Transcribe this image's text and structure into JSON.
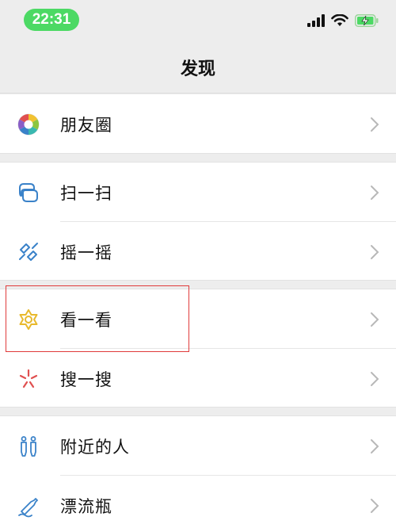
{
  "status_bar": {
    "time": "22:31",
    "icons": [
      "signal-icon",
      "wifi-icon",
      "battery-charging-icon"
    ],
    "accent": "#4cd964"
  },
  "nav": {
    "title": "发现"
  },
  "groups": [
    {
      "items": [
        {
          "label": "朋友圈",
          "icon": "moments-icon"
        }
      ]
    },
    {
      "items": [
        {
          "label": "扫一扫",
          "icon": "scan-icon"
        },
        {
          "label": "摇一摇",
          "icon": "shake-icon"
        }
      ]
    },
    {
      "items": [
        {
          "label": "看一看",
          "icon": "top-stories-icon",
          "highlighted": true
        },
        {
          "label": "搜一搜",
          "icon": "search-icon"
        }
      ]
    },
    {
      "items": [
        {
          "label": "附近的人",
          "icon": "people-nearby-icon"
        },
        {
          "label": "漂流瓶",
          "icon": "drift-bottle-icon"
        }
      ]
    }
  ],
  "colors": {
    "background": "#ededed",
    "highlight": "#e03b3b",
    "icon_blue": "#3a82c9",
    "icon_yellow": "#e8b92c",
    "icon_red": "#e05050"
  }
}
